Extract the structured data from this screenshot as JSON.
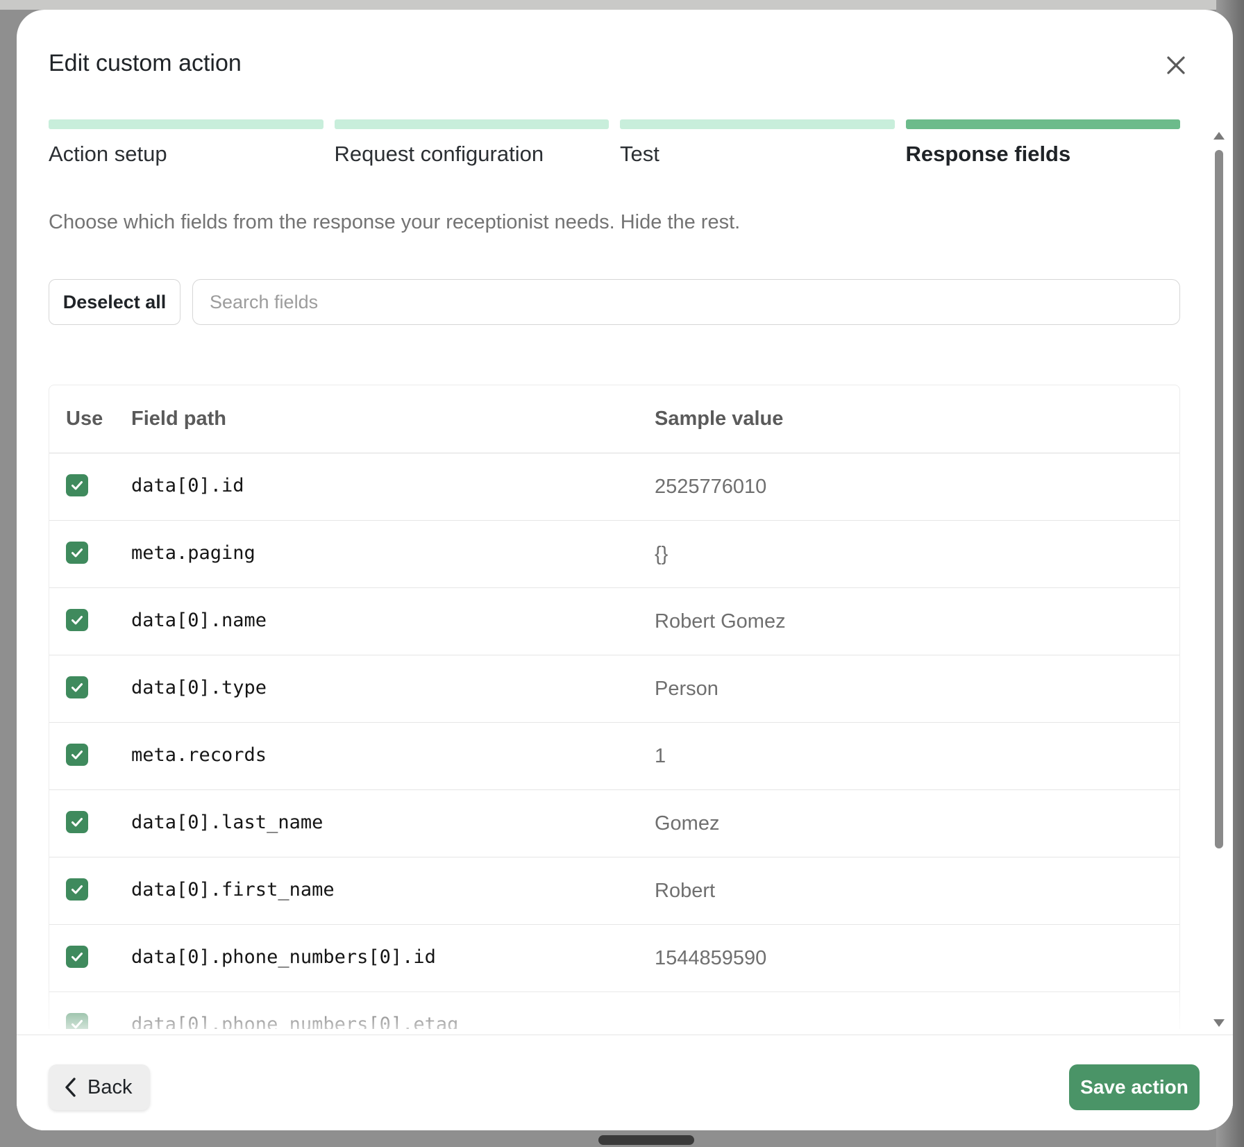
{
  "modal": {
    "title": "Edit custom action",
    "description": "Choose which fields from the response your receptionist needs. Hide the rest."
  },
  "steps": [
    {
      "label": "Action setup",
      "active": false
    },
    {
      "label": "Request configuration",
      "active": false
    },
    {
      "label": "Test",
      "active": false
    },
    {
      "label": "Response fields",
      "active": true
    }
  ],
  "toolbar": {
    "deselect_label": "Deselect all",
    "search_placeholder": "Search fields",
    "search_value": ""
  },
  "table": {
    "headers": {
      "use": "Use",
      "path": "Field path",
      "value": "Sample value"
    },
    "rows": [
      {
        "checked": true,
        "path": "data[0].id",
        "value": "2525776010"
      },
      {
        "checked": true,
        "path": "meta.paging",
        "value": "{}"
      },
      {
        "checked": true,
        "path": "data[0].name",
        "value": "Robert Gomez"
      },
      {
        "checked": true,
        "path": "data[0].type",
        "value": "Person"
      },
      {
        "checked": true,
        "path": "meta.records",
        "value": "1"
      },
      {
        "checked": true,
        "path": "data[0].last_name",
        "value": "Gomez"
      },
      {
        "checked": true,
        "path": "data[0].first_name",
        "value": "Robert"
      },
      {
        "checked": true,
        "path": "data[0].phone_numbers[0].id",
        "value": "1544859590"
      },
      {
        "checked": true,
        "path": "data[0].phone_numbers[0].etag",
        "value": ""
      }
    ]
  },
  "footer": {
    "back_label": "Back",
    "save_label": "Save action"
  },
  "icons": {
    "close": "close-icon",
    "check": "check-icon",
    "back": "chevron-left-icon"
  },
  "colors": {
    "accent": "#4a9467",
    "step_active": "#6cbb8b",
    "step_inactive": "#c8eedb",
    "checkbox": "#3f8a5d"
  }
}
